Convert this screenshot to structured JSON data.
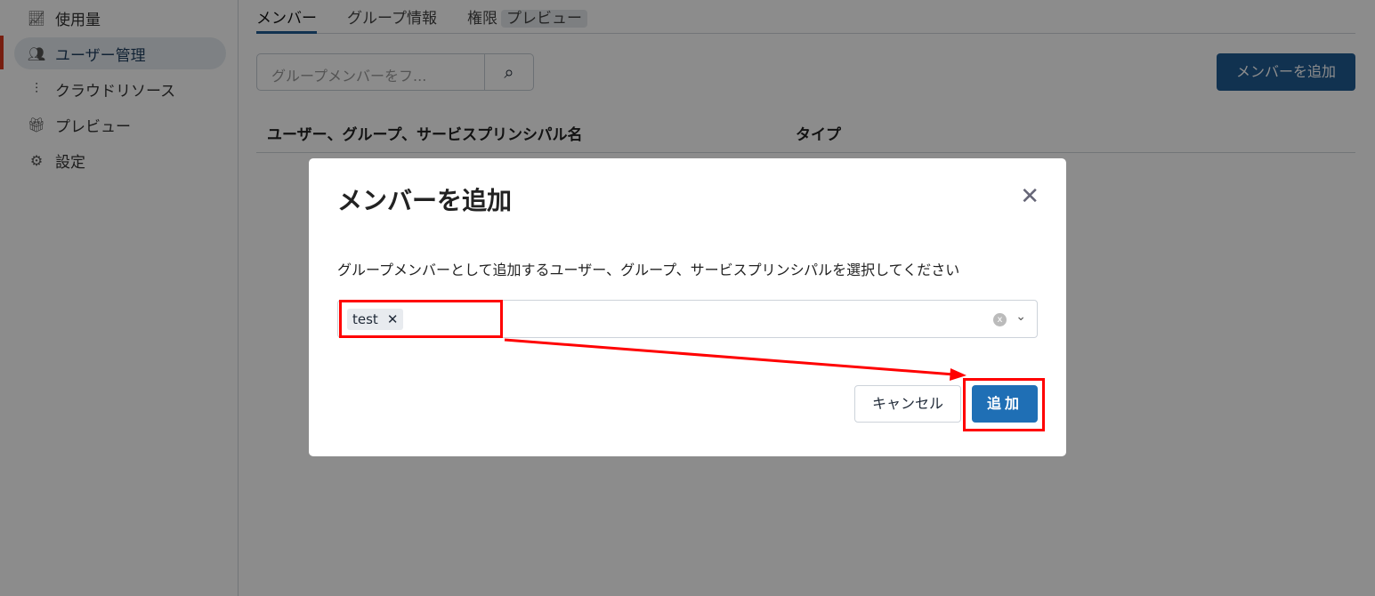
{
  "sidebar": {
    "items": [
      {
        "label": "使用量",
        "icon": "chart-line-icon"
      },
      {
        "label": "ユーザー管理",
        "icon": "users-icon"
      },
      {
        "label": "クラウドリソース",
        "icon": "sliders-icon"
      },
      {
        "label": "プレビュー",
        "icon": "gift-icon"
      },
      {
        "label": "設定",
        "icon": "gear-icon"
      }
    ]
  },
  "tabs": [
    {
      "label": "メンバー"
    },
    {
      "label": "グループ情報"
    },
    {
      "label": "権限"
    }
  ],
  "tab_badge": "プレビュー",
  "search": {
    "placeholder": "グループメンバーをフ..."
  },
  "add_member_button": "メンバーを追加",
  "table": {
    "headers": [
      "ユーザー、グループ、サービスプリンシパル名",
      "タイプ"
    ]
  },
  "modal": {
    "title": "メンバーを追加",
    "description": "グループメンバーとして追加するユーザー、グループ、サービスプリンシパルを選択してください",
    "selected": [
      "test"
    ],
    "cancel": "キャンセル",
    "add": "追加"
  },
  "colors": {
    "primary": "#1f5b93",
    "highlight": "#ff0000"
  }
}
